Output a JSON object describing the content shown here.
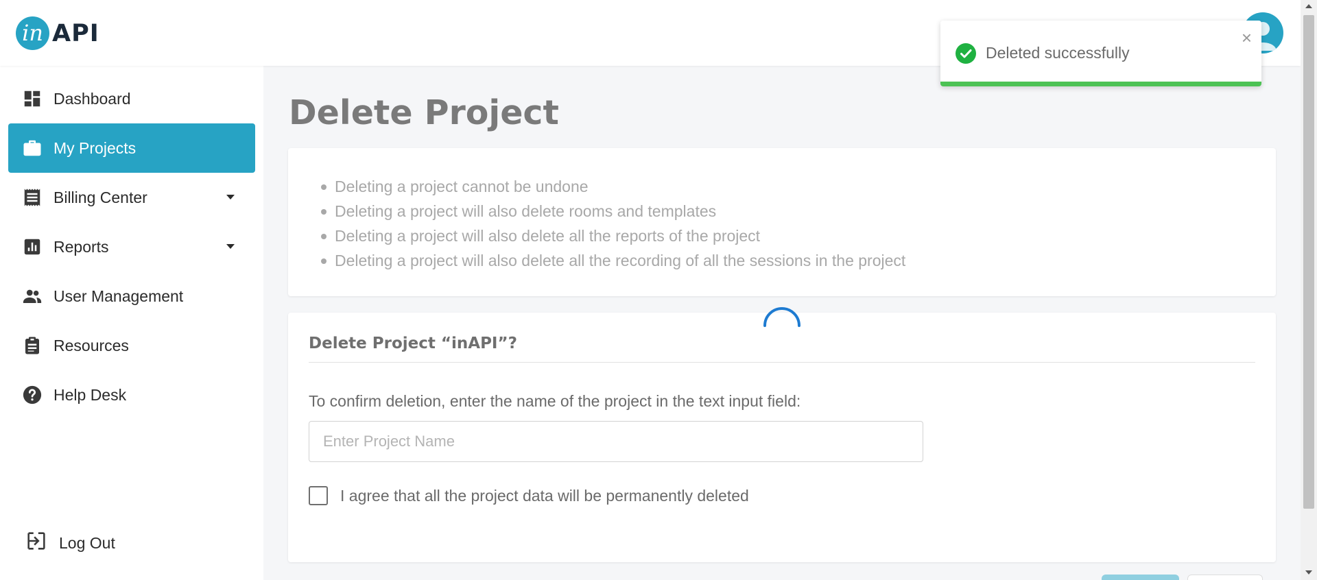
{
  "app": {
    "logo_mark": "in",
    "logo_text": "API"
  },
  "sidebar": {
    "items": [
      {
        "label": "Dashboard",
        "icon": "dashboard-icon"
      },
      {
        "label": "My Projects",
        "icon": "briefcase-icon",
        "active": true
      },
      {
        "label": "Billing Center",
        "icon": "receipt-icon",
        "has_dropdown": true
      },
      {
        "label": "Reports",
        "icon": "bar-chart-icon",
        "has_dropdown": true
      },
      {
        "label": "User Management",
        "icon": "people-icon"
      },
      {
        "label": "Resources",
        "icon": "clipboard-icon"
      },
      {
        "label": "Help Desk",
        "icon": "help-icon"
      }
    ],
    "logout_label": "Log Out"
  },
  "main": {
    "title": "Delete Project",
    "warnings": [
      "Deleting a project cannot be undone",
      "Deleting a project will also delete rooms and templates",
      "Deleting a project will also delete all the reports of the project",
      "Deleting a project will also delete all the recording of all the sessions in the project"
    ],
    "form": {
      "heading": "Delete Project “inAPI”?",
      "instruction": "To confirm deletion, enter the name of the project in the text input field:",
      "input_placeholder": "Enter Project Name",
      "input_value": "",
      "agree_label": "I agree that all the project data will be permanently deleted",
      "agree_checked": false
    }
  },
  "toast": {
    "message": "Deleted successfully",
    "close_glyph": "×",
    "type": "success"
  },
  "colors": {
    "accent": "#27a3c4",
    "success": "#4cc254",
    "spinner": "#1e7bd1"
  }
}
